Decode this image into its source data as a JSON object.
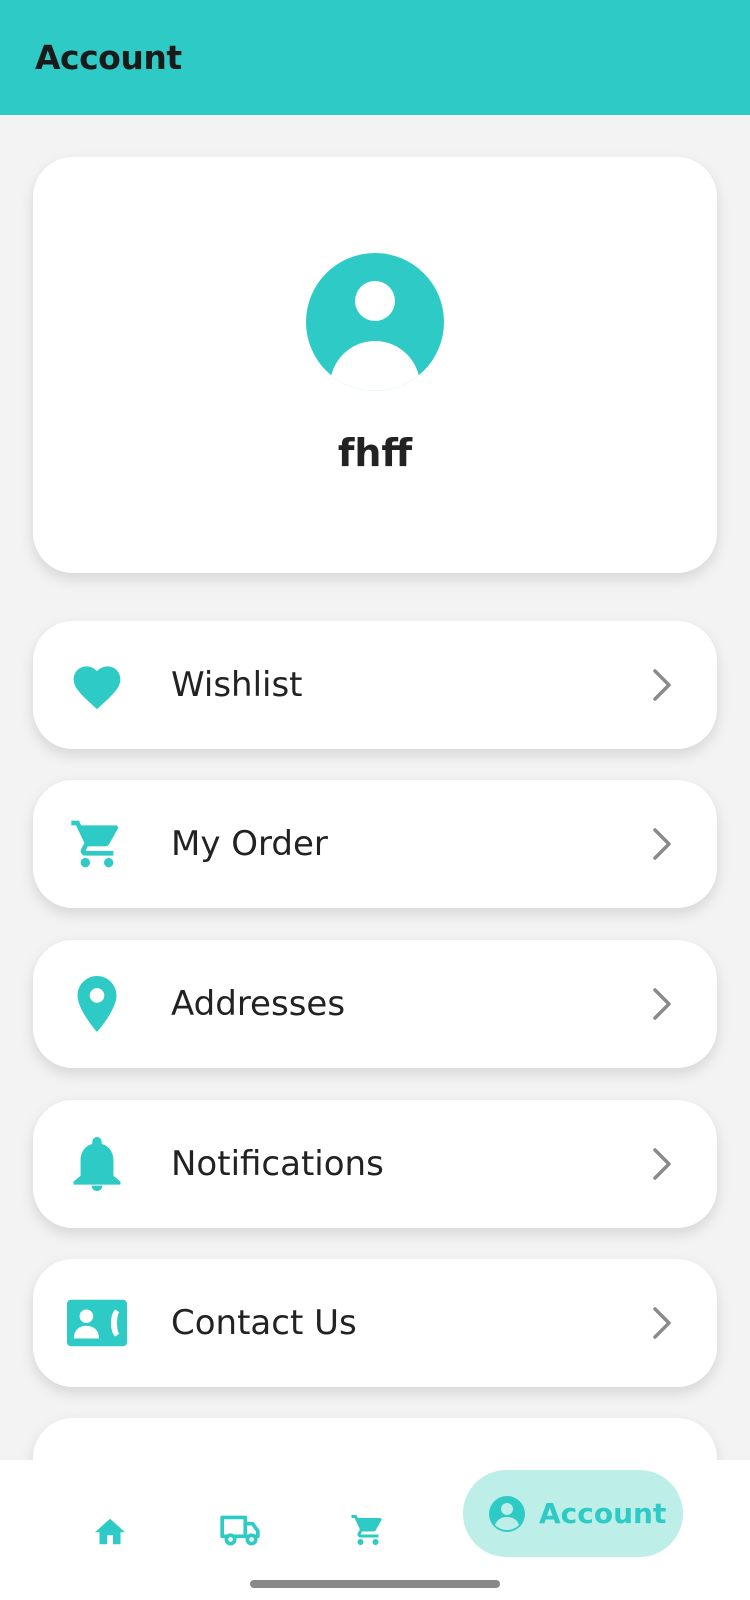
{
  "app_bar": {
    "title": "Account"
  },
  "profile": {
    "name": "fhff",
    "avatar_icon": "account-circle-icon"
  },
  "menu": [
    {
      "label": "Wishlist",
      "icon": "heart-icon"
    },
    {
      "label": "My Order",
      "icon": "cart-icon"
    },
    {
      "label": "Addresses",
      "icon": "location-pin-icon"
    },
    {
      "label": "Notifications",
      "icon": "bell-icon"
    },
    {
      "label": "Contact Us",
      "icon": "contact-phone-icon"
    }
  ],
  "bottom_nav": {
    "items": [
      {
        "icon": "home-icon"
      },
      {
        "icon": "truck-icon"
      },
      {
        "icon": "cart-icon"
      },
      {
        "icon": "account-circle-icon",
        "label": "Account",
        "active": true
      }
    ]
  },
  "colors": {
    "accent": "#2ecbc6",
    "active_pill": "#bdeee8",
    "background": "#f3f3f3",
    "chevron": "#8a8a8a"
  }
}
